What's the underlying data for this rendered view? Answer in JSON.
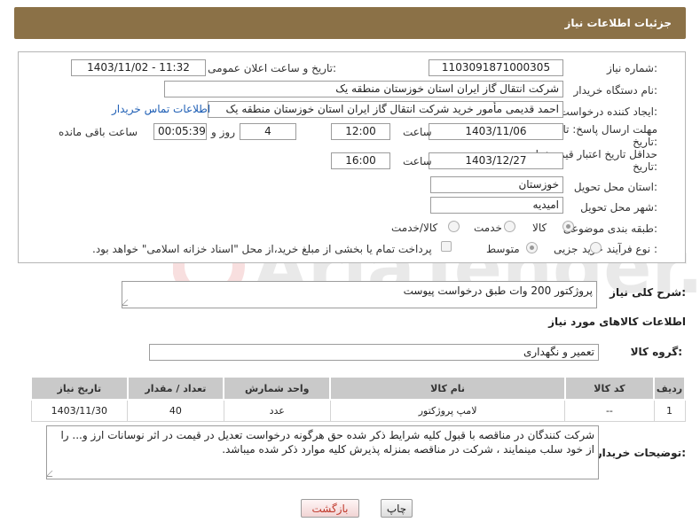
{
  "header": {
    "title": "جزئیات اطلاعات نیاز"
  },
  "fields": {
    "need_number_label": "شماره نیاز:",
    "need_number": "1103091871000305",
    "announce_label": "تاریخ و ساعت اعلان عمومی:",
    "announce_value": "1403/11/02 - 11:32",
    "buyer_label": "نام دستگاه خریدار:",
    "buyer_value": "شرکت انتقال گاز ایران  استان خوزستان منطقه یک",
    "requester_label": "ایجاد کننده درخواست:",
    "requester_value": "احمد  قدیمی مأمور خرید شرکت انتقال گاز ایران  استان خوزستان منطقه یک",
    "contact_link": "اطلاعات تماس خریدار",
    "deadline_label_1": "مهلت ارسال پاسخ: تا",
    "deadline_label_2": "تاریخ:",
    "deadline_date": "1403/11/06",
    "time_label": "ساعت",
    "deadline_time": "12:00",
    "days_value": "4",
    "days_label": "روز و",
    "remaining_value": "00:05:39",
    "remaining_label": "ساعت باقی مانده",
    "validity_label_1": "حداقل تاریخ اعتبار قیمت: تا",
    "validity_label_2": "تاریخ:",
    "validity_date": "1403/12/27",
    "validity_time": "16:00",
    "province_label": "استان محل تحویل:",
    "province_value": "خوزستان",
    "city_label": "شهر محل تحویل:",
    "city_value": "امیدیه",
    "category_label": "طبقه بندی موضوعی:",
    "category_options": [
      "کالا",
      "خدمت",
      "کالا/خدمت"
    ],
    "process_label": "نوع فرآیند خرید :",
    "process_options": [
      "جزیی",
      "متوسط"
    ],
    "payment_note": "پرداخت تمام یا بخشی از مبلغ خرید،از محل \"اسناد خزانه اسلامی\" خواهد بود."
  },
  "summary": {
    "label": "شرح کلی نیاز:",
    "value": "پروژکتور 200 وات طبق درخواست پیوست"
  },
  "goods_info_title": "اطلاعات کالاهای مورد نیاز",
  "goods_group": {
    "label": "گروه کالا:",
    "value": "تعمیر و نگهداری"
  },
  "table": {
    "headers": [
      "ردیف",
      "کد کالا",
      "نام کالا",
      "واحد شمارش",
      "تعداد / مقدار",
      "تاریخ نیاز"
    ],
    "rows": [
      [
        "1",
        "--",
        "لامپ پروژکتور",
        "عدد",
        "40",
        "1403/11/30"
      ]
    ]
  },
  "buyer_notes": {
    "label": "توضیحات خریدار:",
    "value": "شرکت کنندگان در مناقصه با قبول کلیه شرایط ذکر شده حق هرگونه درخواست تعدیل در قیمت در اثر نوسانات ارز و... را از خود سلب مینمایند ، شرکت در مناقصه بمنزله پذیرش کلیه موارد ذکر شده میباشد."
  },
  "buttons": {
    "print": "چاپ",
    "back": "بازگشت"
  },
  "watermark": {
    "text": "AriaTender.net"
  },
  "colors": {
    "header_bg": "#8b7147",
    "link": "#1f5fb5",
    "back_button_text": "#c0392b"
  }
}
